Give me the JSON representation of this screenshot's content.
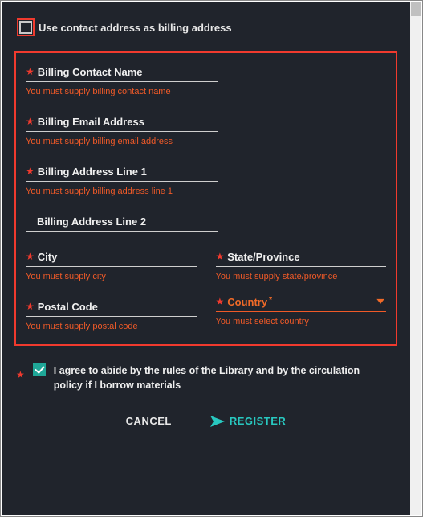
{
  "checkbox_use_contact": {
    "label": "Use contact address as billing address",
    "checked": false
  },
  "fields": {
    "billing_contact_name": {
      "label": "Billing Contact Name",
      "error": "You must supply billing contact name"
    },
    "billing_email": {
      "label": "Billing Email Address",
      "error": "You must supply billing email address"
    },
    "billing_addr1": {
      "label": "Billing Address Line 1",
      "error": "You must supply billing address line 1"
    },
    "billing_addr2": {
      "label": "Billing Address Line 2"
    },
    "city": {
      "label": "City",
      "error": "You must supply city"
    },
    "state": {
      "label": "State/Province",
      "error": "You must supply state/province"
    },
    "postal": {
      "label": "Postal Code",
      "error": "You must supply postal code"
    },
    "country": {
      "label": "Country",
      "error": "You must select country"
    }
  },
  "agree": {
    "label": "I agree to abide by the rules of the Library and by the circulation policy if I borrow materials",
    "checked": true
  },
  "actions": {
    "cancel": "CANCEL",
    "register": "REGISTER"
  },
  "colors": {
    "accent_error": "#f03a2e",
    "accent_link": "#28c8c0",
    "background": "#20242c"
  }
}
